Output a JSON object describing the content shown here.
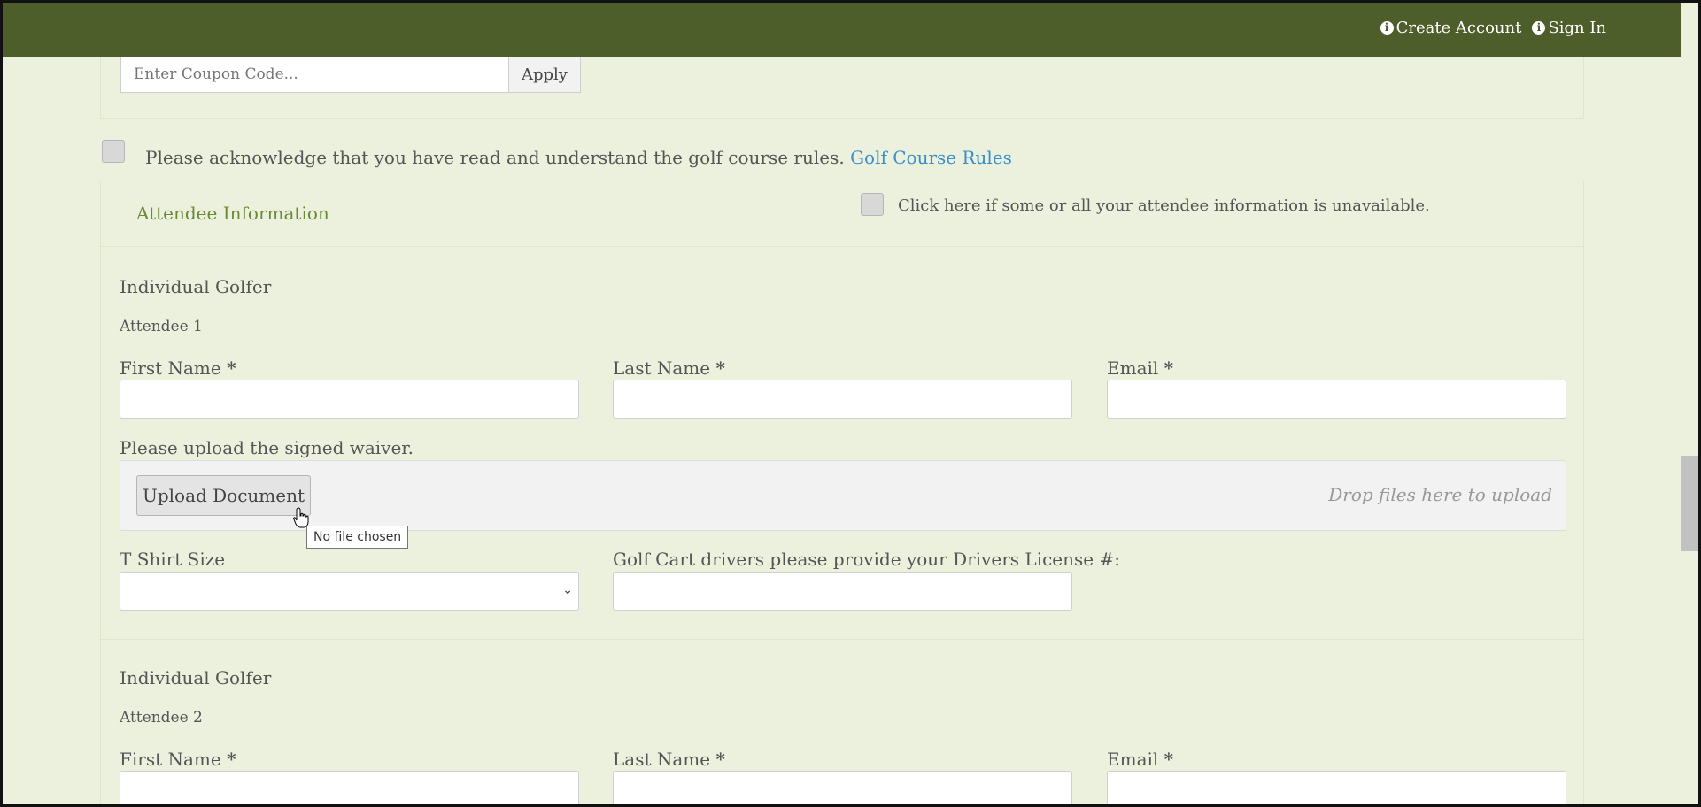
{
  "header": {
    "create_account": "Create Account",
    "sign_in": "Sign In"
  },
  "coupon": {
    "placeholder": "Enter Coupon Code...",
    "apply_label": "Apply"
  },
  "acknowledge": {
    "text": "Please acknowledge that you have read and understand the golf course rules.",
    "link": "Golf Course Rules"
  },
  "attendee_section": {
    "title": "Attendee Information",
    "unavailable_text": "Click here if some or all your attendee information is unavailable."
  },
  "attendees": [
    {
      "type": "Individual Golfer",
      "label": "Attendee 1",
      "first_name_label": "First Name",
      "last_name_label": "Last Name",
      "email_label": "Email",
      "required_mark": "*",
      "waiver_label": "Please upload the signed waiver.",
      "upload_button": "Upload Document",
      "drop_text": "Drop files here to upload",
      "tooltip": "No file chosen",
      "tshirt_label": "T Shirt Size",
      "license_label": "Golf Cart drivers please provide your Drivers License #:"
    },
    {
      "type": "Individual Golfer",
      "label": "Attendee 2",
      "first_name_label": "First Name",
      "last_name_label": "Last Name",
      "email_label": "Email",
      "required_mark": "*"
    }
  ]
}
